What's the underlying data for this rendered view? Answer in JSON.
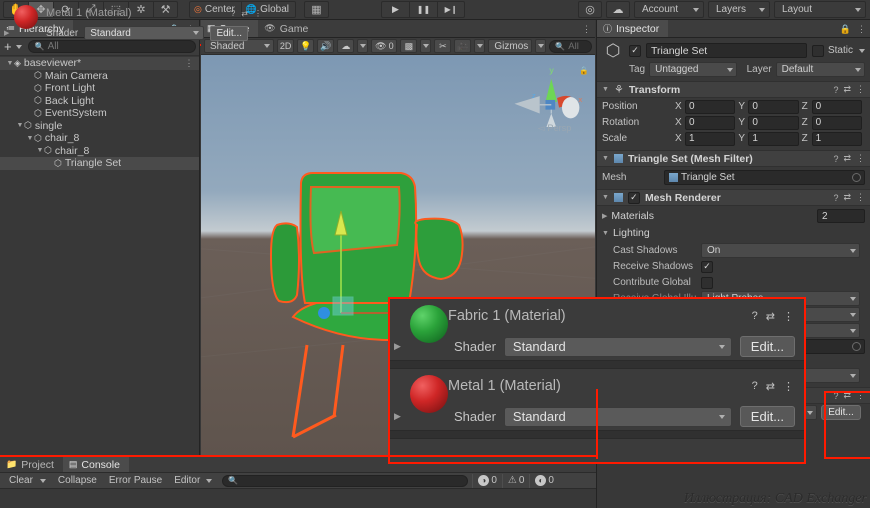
{
  "toolbar": {
    "tools": [
      {
        "name": "hand-tool",
        "glyph": "✋",
        "active": false
      },
      {
        "name": "move-tool",
        "glyph": "✥",
        "active": true
      },
      {
        "name": "rotate-tool",
        "glyph": "⟳",
        "active": false
      },
      {
        "name": "scale-tool",
        "glyph": "⤢",
        "active": false
      },
      {
        "name": "rect-tool",
        "glyph": "⬚",
        "active": false
      },
      {
        "name": "transform-tool",
        "glyph": "✲",
        "active": false
      },
      {
        "name": "custom-tool",
        "glyph": "⚒",
        "active": false
      }
    ],
    "pivot_label": "Center",
    "handle_label": "Global",
    "grid_glyph": "▦",
    "play_label": "▶",
    "pause_label": "❚❚",
    "step_label": "▶❙",
    "cloud_glyph": "☁",
    "services_glyph": "◎",
    "account_label": "Account",
    "layers_label": "Layers",
    "layout_label": "Layout"
  },
  "hierarchy": {
    "tab_label": "Hierarchy",
    "lock_glyph": "🔒",
    "menu_glyph": "⋮",
    "add_label": "+",
    "search_placeholder": "All",
    "search_value": "",
    "items": [
      {
        "label": "baseviewer*",
        "depth": 0,
        "arrow": "▼",
        "icon": "◈",
        "selected": false,
        "root": true
      },
      {
        "label": "Main Camera",
        "depth": 2,
        "arrow": "",
        "icon": "⬡",
        "selected": false,
        "root": false
      },
      {
        "label": "Front Light",
        "depth": 2,
        "arrow": "",
        "icon": "⬡",
        "selected": false,
        "root": false
      },
      {
        "label": "Back Light",
        "depth": 2,
        "arrow": "",
        "icon": "⬡",
        "selected": false,
        "root": false
      },
      {
        "label": "EventSystem",
        "depth": 2,
        "arrow": "",
        "icon": "⬡",
        "selected": false,
        "root": false
      },
      {
        "label": "single",
        "depth": 1,
        "arrow": "▼",
        "icon": "⬡",
        "selected": false,
        "root": false
      },
      {
        "label": "chair_8",
        "depth": 2,
        "arrow": "▼",
        "icon": "⬡",
        "selected": false,
        "root": false
      },
      {
        "label": "chair_8",
        "depth": 3,
        "arrow": "▼",
        "icon": "⬡",
        "selected": false,
        "root": false
      },
      {
        "label": "Triangle Set",
        "depth": 4,
        "arrow": "",
        "icon": "⬡",
        "selected": true,
        "root": false
      }
    ]
  },
  "scene": {
    "tabs": [
      {
        "label": "Scene",
        "icon": "▦",
        "selected": true
      },
      {
        "label": "Game",
        "icon": "👁",
        "selected": false
      }
    ],
    "menu_glyph": "⋮",
    "draw_mode": "Shaded",
    "mode_2d": "2D",
    "light_glyph": "💡",
    "audio_glyph": "🔊",
    "fx_glyph": "☁",
    "hidden_count": "0",
    "grid_glyph": "▩",
    "tools_glyph": "✂",
    "camera_glyph": "🎥",
    "gizmos_label": "Gizmos",
    "search_placeholder": "All",
    "gizmo_axis_x": "x",
    "gizmo_axis_y": "y",
    "gizmo_axis_z": "z",
    "gizmo_persp": "Persp",
    "gizmo_lock_glyph": "🔒"
  },
  "inspector": {
    "tab_label": "Inspector",
    "tab_icon": "ⓘ",
    "lock_glyph": "🔒",
    "menu_glyph": "⋮",
    "object_name": "Triangle Set",
    "enabled_check": "✓",
    "static_label": "Static",
    "tag_label": "Tag",
    "tag_value": "Untagged",
    "layer_label": "Layer",
    "layer_value": "Default",
    "transform": {
      "title": "Transform",
      "rows": [
        {
          "label": "Position",
          "x": "0",
          "y": "0",
          "z": "0"
        },
        {
          "label": "Rotation",
          "x": "0",
          "y": "0",
          "z": "0"
        },
        {
          "label": "Scale",
          "x": "1",
          "y": "1",
          "z": "1"
        }
      ]
    },
    "mesh_filter": {
      "title": "Triangle Set (Mesh Filter)",
      "mesh_label": "Mesh",
      "mesh_value": "Triangle Set"
    },
    "mesh_renderer": {
      "title": "Mesh Renderer",
      "materials_label": "Materials",
      "materials_count": "2",
      "lighting_label": "Lighting",
      "cast_shadows_label": "Cast Shadows",
      "cast_shadows_value": "On",
      "receive_shadows_label": "Receive Shadows",
      "receive_shadows_check": "✓",
      "contribute_global_label": "Contribute Global",
      "receive_gi_label": "Receive Global Illu",
      "receive_gi_value": "Light Probes"
    },
    "help_glyph": "?",
    "preset_glyph": "⇄",
    "kebab_glyph": "⋮"
  },
  "materials_callout": {
    "blocks": [
      {
        "title": "Fabric 1 (Material)",
        "sphere_color": "#2ba33a",
        "sphere_class": "green",
        "shader_label": "Shader",
        "shader_value": "Standard",
        "edit_label": "Edit..."
      },
      {
        "title": "Metal 1 (Material)",
        "sphere_color": "#cf2626",
        "sphere_class": "red",
        "shader_label": "Shader",
        "shader_value": "Standard",
        "edit_label": "Edit..."
      }
    ],
    "help_glyph": "?",
    "preset_glyph": "⇄",
    "kebab_glyph": "⋮",
    "expand_glyph": "▶",
    "border_color": "#ff1a00"
  },
  "material_small": {
    "title": "Metal 1 (Material)",
    "shader_label": "Shader",
    "shader_value": "Standard",
    "edit_label": "Edit...",
    "help_glyph": "?",
    "preset_glyph": "⇄",
    "kebab_glyph": "⋮"
  },
  "console": {
    "tabs": [
      {
        "label": "Project",
        "icon": "📁",
        "selected": false
      },
      {
        "label": "Console",
        "icon": "▤",
        "selected": true
      }
    ],
    "clear_label": "Clear",
    "collapse_label": "Collapse",
    "error_pause_label": "Error Pause",
    "editor_label": "Editor",
    "search_placeholder": "",
    "log_count": "0",
    "warn_count": "0",
    "error_count": "0",
    "log_glyph": "◑",
    "warn_glyph": "⚠",
    "error_glyph": "◐"
  },
  "watermark": "Иллюстрация: CAD Exchanger"
}
